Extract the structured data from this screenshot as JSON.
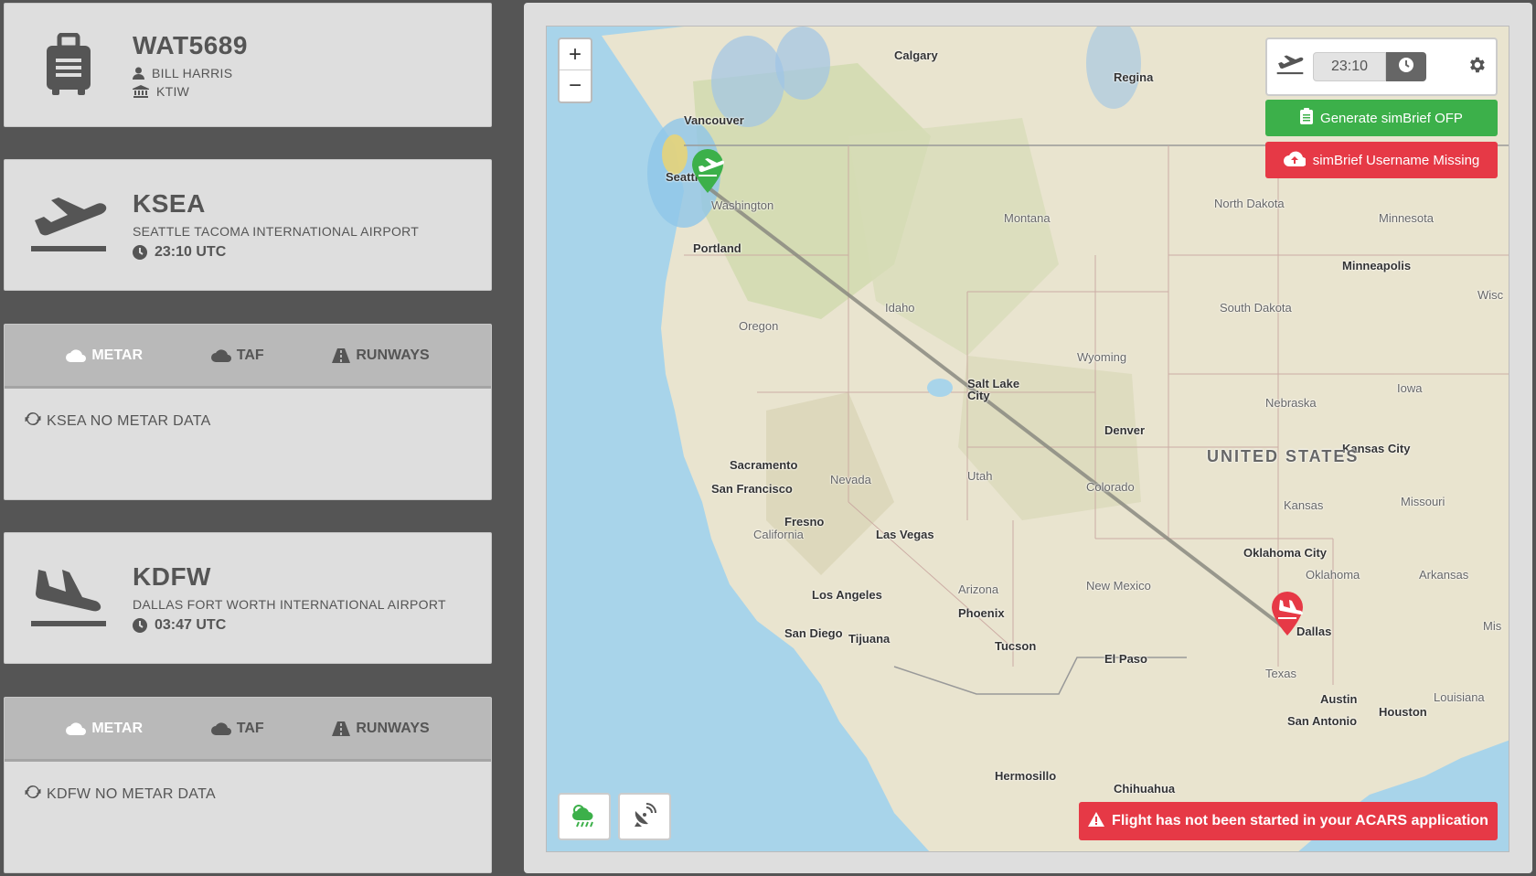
{
  "flight": {
    "callsign": "WAT5689",
    "pilot": "BILL HARRIS",
    "aircraft": "KTIW"
  },
  "departure": {
    "icao": "KSEA",
    "name": "SEATTLE TACOMA INTERNATIONAL AIRPORT",
    "time": "23:10 UTC"
  },
  "arrival": {
    "icao": "KDFW",
    "name": "DALLAS FORT WORTH INTERNATIONAL AIRPORT",
    "time": "03:47 UTC"
  },
  "tabs": {
    "metar": "METAR",
    "taf": "TAF",
    "runways": "RUNWAYS"
  },
  "dep_weather": {
    "message": "KSEA NO METAR DATA"
  },
  "arr_weather": {
    "message": "KDFW NO METAR DATA"
  },
  "map": {
    "zoom_in": "+",
    "zoom_out": "−",
    "departure_time_input": "23:10",
    "generate_button": "Generate simBrief OFP",
    "username_button": "simBrief Username Missing",
    "alert": "Flight has not been started in your ACARS application",
    "labels": {
      "cities": [
        "Calgary",
        "Regina",
        "Vancouver",
        "Seattle",
        "Portland",
        "Minneapolis",
        "Salt Lake City",
        "Denver",
        "Kansas City",
        "Sacramento",
        "San Francisco",
        "Fresno",
        "Las Vegas",
        "Los Angeles",
        "San Diego",
        "Tijuana",
        "Phoenix",
        "Tucson",
        "El Paso",
        "Oklahoma City",
        "Dallas",
        "Austin",
        "San Antonio",
        "Houston",
        "Hermosillo",
        "Chihuahua"
      ],
      "states": [
        "Washington",
        "Montana",
        "North Dakota",
        "Minnesota",
        "Oregon",
        "Idaho",
        "South Dakota",
        "Wyoming",
        "Nebraska",
        "Iowa",
        "Nevada",
        "Utah",
        "Colorado",
        "Kansas",
        "Missouri",
        "California",
        "Arizona",
        "New Mexico",
        "Oklahoma",
        "Arkansas",
        "Texas",
        "Louisiana",
        "Wisc",
        "Mis"
      ],
      "country": "UNITED STATES"
    },
    "colors": {
      "departure_pin": "#3cb04a",
      "arrival_pin": "#e63946",
      "route": "#8a8a80"
    }
  }
}
